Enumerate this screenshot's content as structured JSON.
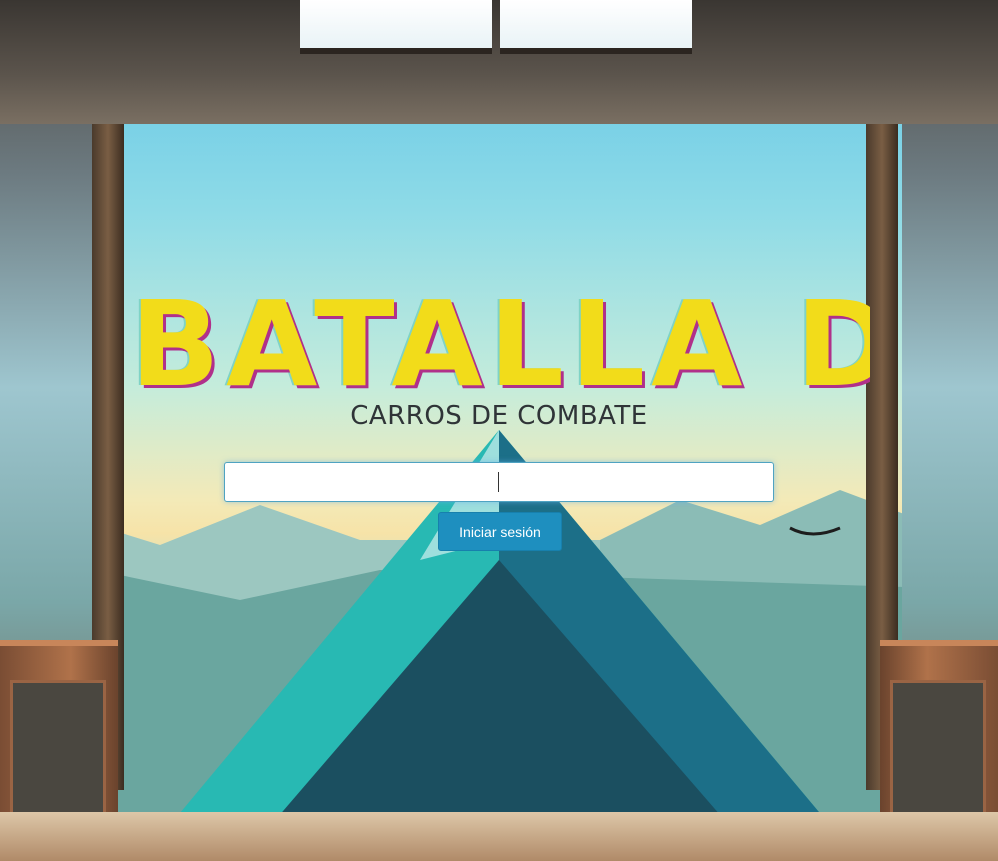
{
  "logo": {
    "title": "BATALLA DE",
    "subtitle": "CARROS DE COMBATE"
  },
  "login": {
    "input_value": "",
    "button_label": "Iniciar sesión"
  },
  "colors": {
    "button": "#1e8fbf",
    "logo_yellow": "#f2dc1a",
    "logo_magenta": "#b0308a",
    "logo_teal": "#7fd3c6"
  }
}
